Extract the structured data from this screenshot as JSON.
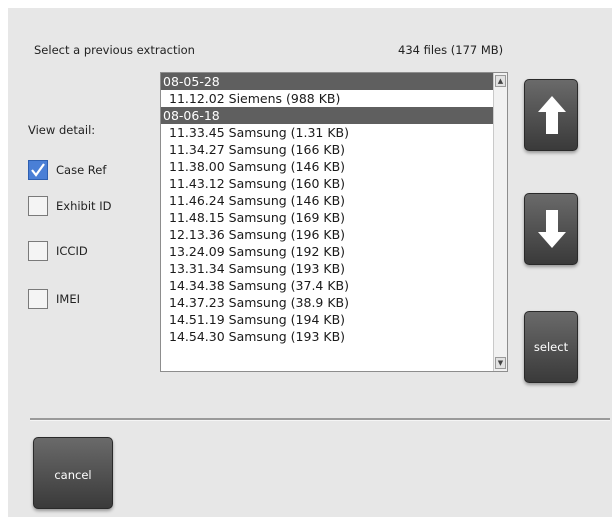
{
  "header": {
    "title": "Select a previous extraction",
    "summary": "434 files (177 MB)"
  },
  "view_detail": {
    "label": "View detail:",
    "options": [
      {
        "label": "Case Ref",
        "checked": true
      },
      {
        "label": "Exhibit ID",
        "checked": false
      },
      {
        "label": "ICCID",
        "checked": false
      },
      {
        "label": "IMEI",
        "checked": false
      }
    ]
  },
  "list": {
    "rows": [
      {
        "type": "group",
        "text": "08-05-28"
      },
      {
        "type": "item",
        "text": "11.12.02 Siemens (988 KB)"
      },
      {
        "type": "group",
        "text": "08-06-18"
      },
      {
        "type": "item",
        "text": "11.33.45 Samsung (1.31 KB)"
      },
      {
        "type": "item",
        "text": "11.34.27 Samsung (166 KB)"
      },
      {
        "type": "item",
        "text": "11.38.00 Samsung (146 KB)"
      },
      {
        "type": "item",
        "text": "11.43.12 Samsung (160 KB)"
      },
      {
        "type": "item",
        "text": "11.46.24 Samsung (146 KB)"
      },
      {
        "type": "item",
        "text": "11.48.15 Samsung (169 KB)"
      },
      {
        "type": "item",
        "text": "12.13.36 Samsung (196 KB)"
      },
      {
        "type": "item",
        "text": "13.24.09 Samsung (192 KB)"
      },
      {
        "type": "item",
        "text": "13.31.34 Samsung (193 KB)"
      },
      {
        "type": "item",
        "text": "14.34.38 Samsung (37.4 KB)"
      },
      {
        "type": "item",
        "text": "14.37.23 Samsung (38.9 KB)"
      },
      {
        "type": "item",
        "text": "14.51.19 Samsung (194 KB)"
      },
      {
        "type": "item",
        "text": "14.54.30 Samsung (193 KB)"
      }
    ]
  },
  "buttons": {
    "up_icon": "arrow-up-icon",
    "down_icon": "arrow-down-icon",
    "select_label": "select",
    "cancel_label": "cancel"
  },
  "colors": {
    "group_row_bg": "#5f5f5f",
    "button_bg": "#4a4a4a",
    "checkbox_checked": "#4a7fd6"
  }
}
